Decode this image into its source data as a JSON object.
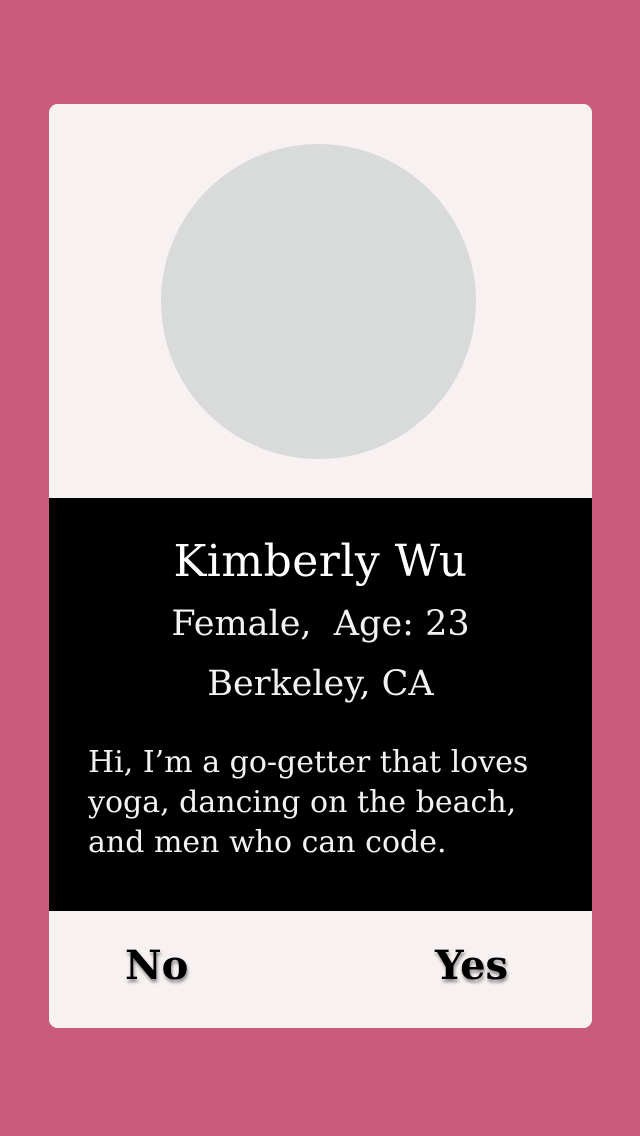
{
  "profile": {
    "name": "Kimberly Wu",
    "gender_age": "Female,  Age: 23",
    "location": "Berkeley, CA",
    "bio": "Hi, I’m a go-getter that loves yoga, dancing on the beach, and men who can code."
  },
  "actions": {
    "no_label": "No",
    "yes_label": "Yes"
  },
  "colors": {
    "background": "#c95c7c",
    "card": "#f7f2f1",
    "avatar_placeholder": "#d9dada",
    "info_panel": "#000000"
  }
}
